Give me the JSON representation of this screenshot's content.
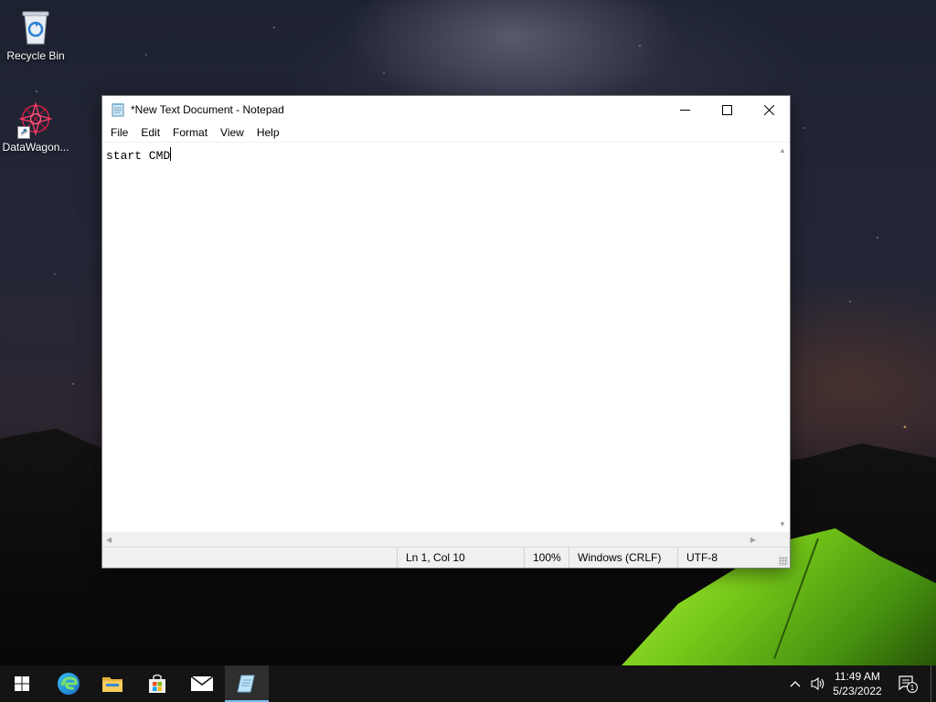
{
  "desktop": {
    "icons": [
      {
        "label": "Recycle Bin",
        "icon": "recycle-bin-icon"
      },
      {
        "label": "DataWagon...",
        "icon": "datawagon-icon"
      }
    ]
  },
  "notepad": {
    "title": "*New Text Document - Notepad",
    "menu": [
      "File",
      "Edit",
      "Format",
      "View",
      "Help"
    ],
    "content": "start CMD",
    "status": {
      "position": "Ln 1, Col 10",
      "zoom": "100%",
      "line_ending": "Windows (CRLF)",
      "encoding": "UTF-8"
    }
  },
  "taskbar": {
    "apps": [
      {
        "name": "start",
        "icon": "windows-start-icon"
      },
      {
        "name": "edge",
        "icon": "edge-browser-icon"
      },
      {
        "name": "file-explorer",
        "icon": "folder-icon"
      },
      {
        "name": "store",
        "icon": "store-bag-icon"
      },
      {
        "name": "mail",
        "icon": "mail-icon"
      },
      {
        "name": "notepad",
        "icon": "notepad-icon",
        "active": true
      }
    ],
    "clock": {
      "time": "11:49 AM",
      "date": "5/23/2022"
    },
    "notifications": "1"
  },
  "colors": {
    "accent": "#76b9ed",
    "taskbar": "#141414",
    "tent": "#7cd21a"
  }
}
